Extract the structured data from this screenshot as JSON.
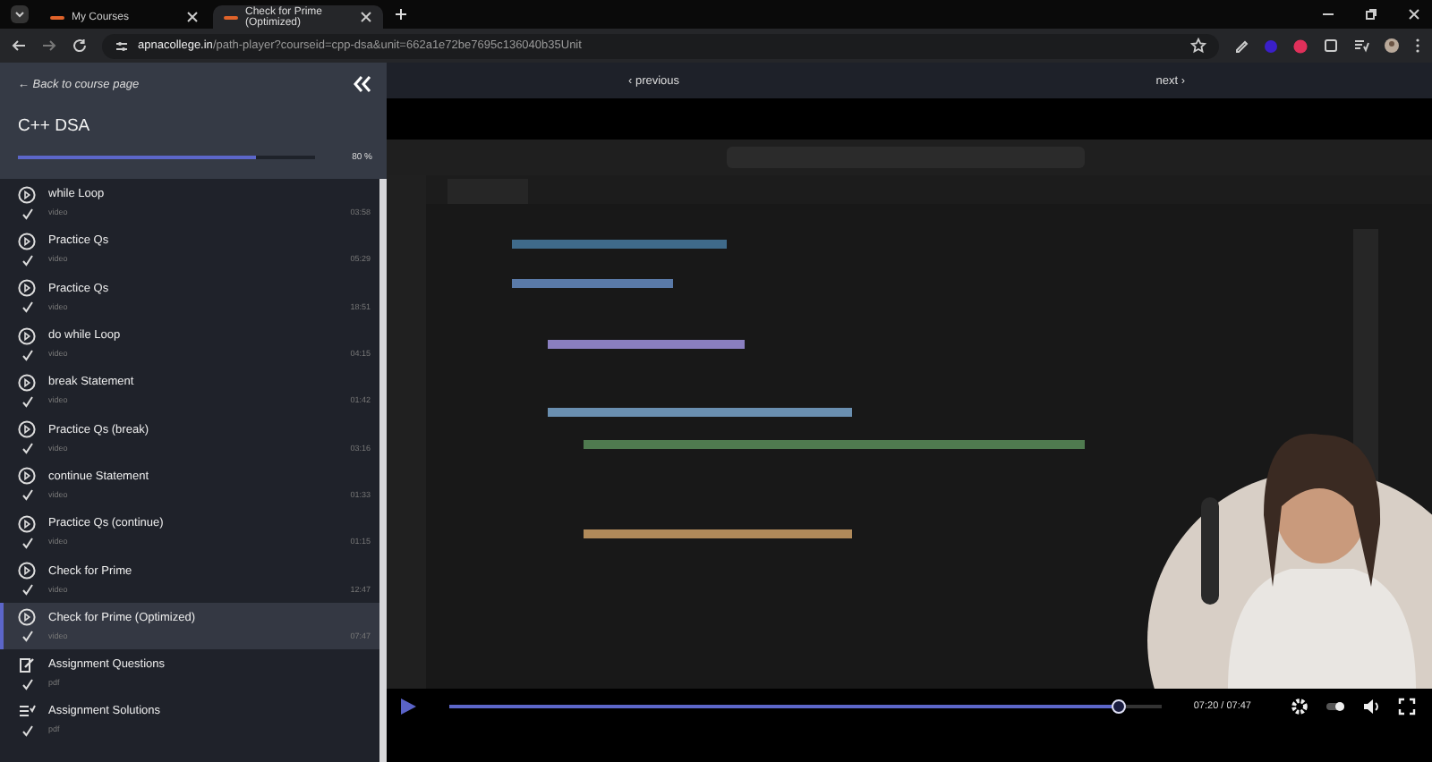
{
  "browser": {
    "tabs": [
      {
        "title": "My Courses",
        "selected": false
      },
      {
        "title": "Check for Prime (Optimized)",
        "selected": true
      }
    ],
    "url": "apnacollege.in/path-player?courseid=cpp-dsa&unit=662a1e72be7695c136040b35Unit"
  },
  "sidebar": {
    "back_link": "← Back to course page",
    "course_title": "C++ DSA",
    "progress": {
      "level": 0.8,
      "reading": "80 %"
    },
    "items": [
      {
        "kind": "video",
        "title": "while Loop",
        "type": "video",
        "duration": "03:58",
        "completed": true,
        "selected": false
      },
      {
        "kind": "video",
        "title": "Practice Qs",
        "type": "video",
        "duration": "05:29",
        "completed": true,
        "selected": false
      },
      {
        "kind": "video",
        "title": "Practice Qs",
        "type": "video",
        "duration": "18:51",
        "completed": true,
        "selected": false
      },
      {
        "kind": "video",
        "title": "do while Loop",
        "type": "video",
        "duration": "04:15",
        "completed": true,
        "selected": false
      },
      {
        "kind": "video",
        "title": "break Statement",
        "type": "video",
        "duration": "01:42",
        "completed": true,
        "selected": false
      },
      {
        "kind": "video",
        "title": "Practice Qs (break)",
        "type": "video",
        "duration": "03:16",
        "completed": true,
        "selected": false
      },
      {
        "kind": "video",
        "title": "continue Statement",
        "type": "video",
        "duration": "01:33",
        "completed": true,
        "selected": false
      },
      {
        "kind": "video",
        "title": "Practice Qs (continue)",
        "type": "video",
        "duration": "01:15",
        "completed": true,
        "selected": false
      },
      {
        "kind": "video",
        "title": "Check for Prime",
        "type": "video",
        "duration": "12:47",
        "completed": true,
        "selected": false
      },
      {
        "kind": "video",
        "title": "Check for Prime (Optimized)",
        "type": "video",
        "duration": "07:47",
        "completed": true,
        "selected": true
      },
      {
        "kind": "assignment",
        "title": "Assignment Questions",
        "type": "pdf",
        "completed": true,
        "selected": false
      },
      {
        "kind": "solution",
        "title": "Assignment Solutions",
        "type": "pdf",
        "completed": true,
        "selected": false
      }
    ]
  },
  "lesson_nav": {
    "previous": "‹ previous",
    "next": "next ›"
  },
  "player": {
    "seek": {
      "level": 0.94
    },
    "time": "07:20 / 07:47"
  }
}
